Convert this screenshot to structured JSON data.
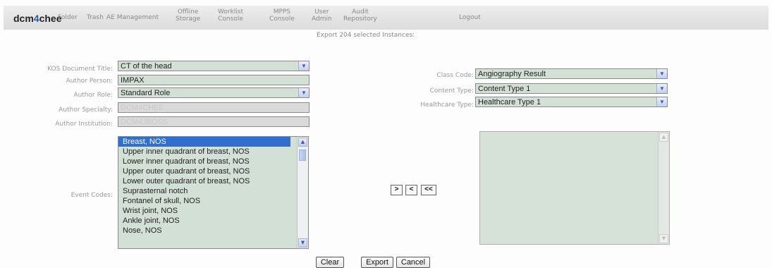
{
  "header": {
    "logo_prefix": "dcm",
    "logo_four": "4",
    "logo_suffix": "chee",
    "nav": [
      "Folder",
      "Trash",
      "AE Management",
      "Offline\nStorage",
      "Worklist\nConsole",
      "MPPS\nConsole",
      "User\nAdmin",
      "Audit\nRepository",
      "Logout"
    ]
  },
  "subtitle": "Export 204 selected Instances:",
  "form": {
    "kos_title_label": "KOS Document Title:",
    "kos_title_value": "CT of the head",
    "author_person_label": "Author Person:",
    "author_person_value": "IMPAX",
    "author_role_label": "Author Role:",
    "author_role_value": "Standard Role",
    "author_specialty_label": "Author Specialty:",
    "author_specialty_value": "DCM4CHEE",
    "author_institution_label": "Author Institution:",
    "author_institution_value": "DCM4JBOSS",
    "class_code_label": "Class Code:",
    "class_code_value": "Angiography Result",
    "content_type_label": "Content Type:",
    "content_type_value": "Content Type 1",
    "healthcare_type_label": "Healthcare Type:",
    "healthcare_type_value": "Healthcare Type 1",
    "event_codes_label": "Event Codes:"
  },
  "event_codes": [
    "Breast, NOS",
    "Upper inner quadrant of breast, NOS",
    "Lower inner quadrant of breast, NOS",
    "Upper outer quadrant of breast, NOS",
    "Lower outer quadrant of breast, NOS",
    "Suprasternal notch",
    "Fontanel of skull, NOS",
    "Wrist joint, NOS",
    "Ankle joint, NOS",
    "Nose, NOS"
  ],
  "transfer_buttons": {
    "add": ">",
    "remove": "<",
    "remove_all": "<<"
  },
  "actions": {
    "clear": "Clear",
    "export": "Export",
    "cancel": "Cancel"
  },
  "icons": {
    "dropdown": "chevron-down-icon",
    "scroll_up": "arrow-up-icon",
    "scroll_down": "arrow-down-icon"
  },
  "colors": {
    "field_green": "#d2e0d5",
    "selection_blue": "#2f6fd0",
    "logo_blue": "#2a5aa6"
  }
}
